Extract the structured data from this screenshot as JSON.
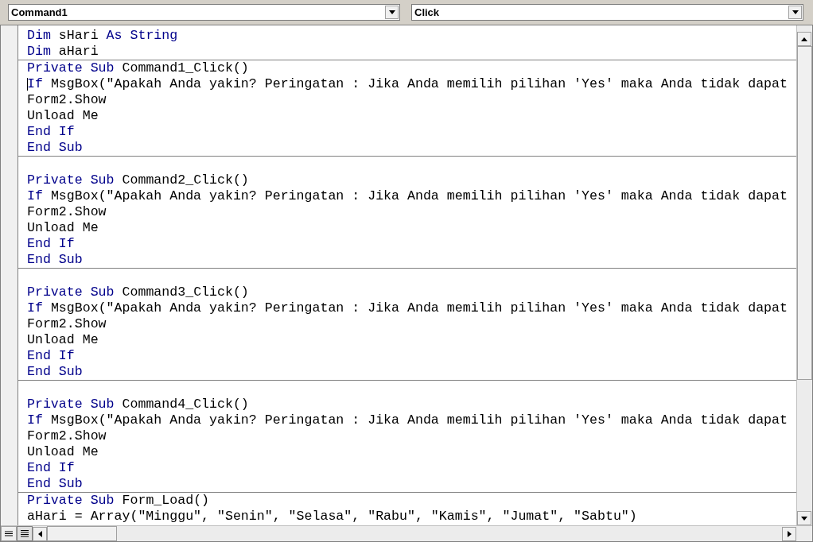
{
  "object_combo": {
    "value": "Command1"
  },
  "procedure_combo": {
    "value": "Click"
  },
  "code_sections": [
    {
      "lines": [
        {
          "kind": "code",
          "tokens": [
            {
              "text": "Dim",
              "kind": "keyword"
            },
            {
              "text": " sHari ",
              "kind": "plain"
            },
            {
              "text": "As String",
              "kind": "keyword"
            }
          ]
        },
        {
          "kind": "code",
          "tokens": [
            {
              "text": "Dim",
              "kind": "keyword"
            },
            {
              "text": " aHari",
              "kind": "plain"
            }
          ]
        }
      ]
    },
    {
      "lines": [
        {
          "kind": "code",
          "tokens": [
            {
              "text": "Private Sub",
              "kind": "keyword"
            },
            {
              "text": " Command1_Click()",
              "kind": "plain"
            }
          ]
        },
        {
          "kind": "code",
          "caret": true,
          "tokens": [
            {
              "text": "If",
              "kind": "keyword"
            },
            {
              "text": " MsgBox(\"Apakah Anda yakin? Peringatan : Jika Anda memilih pilihan 'Yes' maka Anda tidak dapat",
              "kind": "plain"
            }
          ]
        },
        {
          "kind": "code",
          "tokens": [
            {
              "text": "Form2.Show",
              "kind": "plain"
            }
          ]
        },
        {
          "kind": "code",
          "tokens": [
            {
              "text": "Unload Me",
              "kind": "plain"
            }
          ]
        },
        {
          "kind": "code",
          "tokens": [
            {
              "text": "End If",
              "kind": "keyword"
            }
          ]
        },
        {
          "kind": "code",
          "tokens": [
            {
              "text": "End Sub",
              "kind": "keyword"
            }
          ]
        }
      ]
    },
    {
      "lines": [
        {
          "kind": "blank"
        },
        {
          "kind": "code",
          "tokens": [
            {
              "text": "Private Sub",
              "kind": "keyword"
            },
            {
              "text": " Command2_Click()",
              "kind": "plain"
            }
          ]
        },
        {
          "kind": "code",
          "tokens": [
            {
              "text": "If",
              "kind": "keyword"
            },
            {
              "text": " MsgBox(\"Apakah Anda yakin? Peringatan : Jika Anda memilih pilihan 'Yes' maka Anda tidak dapat",
              "kind": "plain"
            }
          ]
        },
        {
          "kind": "code",
          "tokens": [
            {
              "text": "Form2.Show",
              "kind": "plain"
            }
          ]
        },
        {
          "kind": "code",
          "tokens": [
            {
              "text": "Unload Me",
              "kind": "plain"
            }
          ]
        },
        {
          "kind": "code",
          "tokens": [
            {
              "text": "End If",
              "kind": "keyword"
            }
          ]
        },
        {
          "kind": "code",
          "tokens": [
            {
              "text": "End Sub",
              "kind": "keyword"
            }
          ]
        }
      ]
    },
    {
      "lines": [
        {
          "kind": "blank"
        },
        {
          "kind": "code",
          "tokens": [
            {
              "text": "Private Sub",
              "kind": "keyword"
            },
            {
              "text": " Command3_Click()",
              "kind": "plain"
            }
          ]
        },
        {
          "kind": "code",
          "tokens": [
            {
              "text": "If",
              "kind": "keyword"
            },
            {
              "text": " MsgBox(\"Apakah Anda yakin? Peringatan : Jika Anda memilih pilihan 'Yes' maka Anda tidak dapat",
              "kind": "plain"
            }
          ]
        },
        {
          "kind": "code",
          "tokens": [
            {
              "text": "Form2.Show",
              "kind": "plain"
            }
          ]
        },
        {
          "kind": "code",
          "tokens": [
            {
              "text": "Unload Me",
              "kind": "plain"
            }
          ]
        },
        {
          "kind": "code",
          "tokens": [
            {
              "text": "End If",
              "kind": "keyword"
            }
          ]
        },
        {
          "kind": "code",
          "tokens": [
            {
              "text": "End Sub",
              "kind": "keyword"
            }
          ]
        }
      ]
    },
    {
      "lines": [
        {
          "kind": "blank"
        },
        {
          "kind": "code",
          "tokens": [
            {
              "text": "Private Sub",
              "kind": "keyword"
            },
            {
              "text": " Command4_Click()",
              "kind": "plain"
            }
          ]
        },
        {
          "kind": "code",
          "tokens": [
            {
              "text": "If",
              "kind": "keyword"
            },
            {
              "text": " MsgBox(\"Apakah Anda yakin? Peringatan : Jika Anda memilih pilihan 'Yes' maka Anda tidak dapat",
              "kind": "plain"
            }
          ]
        },
        {
          "kind": "code",
          "tokens": [
            {
              "text": "Form2.Show",
              "kind": "plain"
            }
          ]
        },
        {
          "kind": "code",
          "tokens": [
            {
              "text": "Unload Me",
              "kind": "plain"
            }
          ]
        },
        {
          "kind": "code",
          "tokens": [
            {
              "text": "End If",
              "kind": "keyword"
            }
          ]
        },
        {
          "kind": "code",
          "tokens": [
            {
              "text": "End Sub",
              "kind": "keyword"
            }
          ]
        }
      ]
    },
    {
      "lines": [
        {
          "kind": "code",
          "tokens": [
            {
              "text": "Private Sub",
              "kind": "keyword"
            },
            {
              "text": " Form_Load()",
              "kind": "plain"
            }
          ]
        },
        {
          "kind": "code",
          "tokens": [
            {
              "text": "aHari = Array(\"Minggu\", \"Senin\", \"Selasa\", \"Rabu\", \"Kamis\", \"Jumat\", \"Sabtu\")",
              "kind": "plain"
            }
          ]
        }
      ]
    }
  ]
}
